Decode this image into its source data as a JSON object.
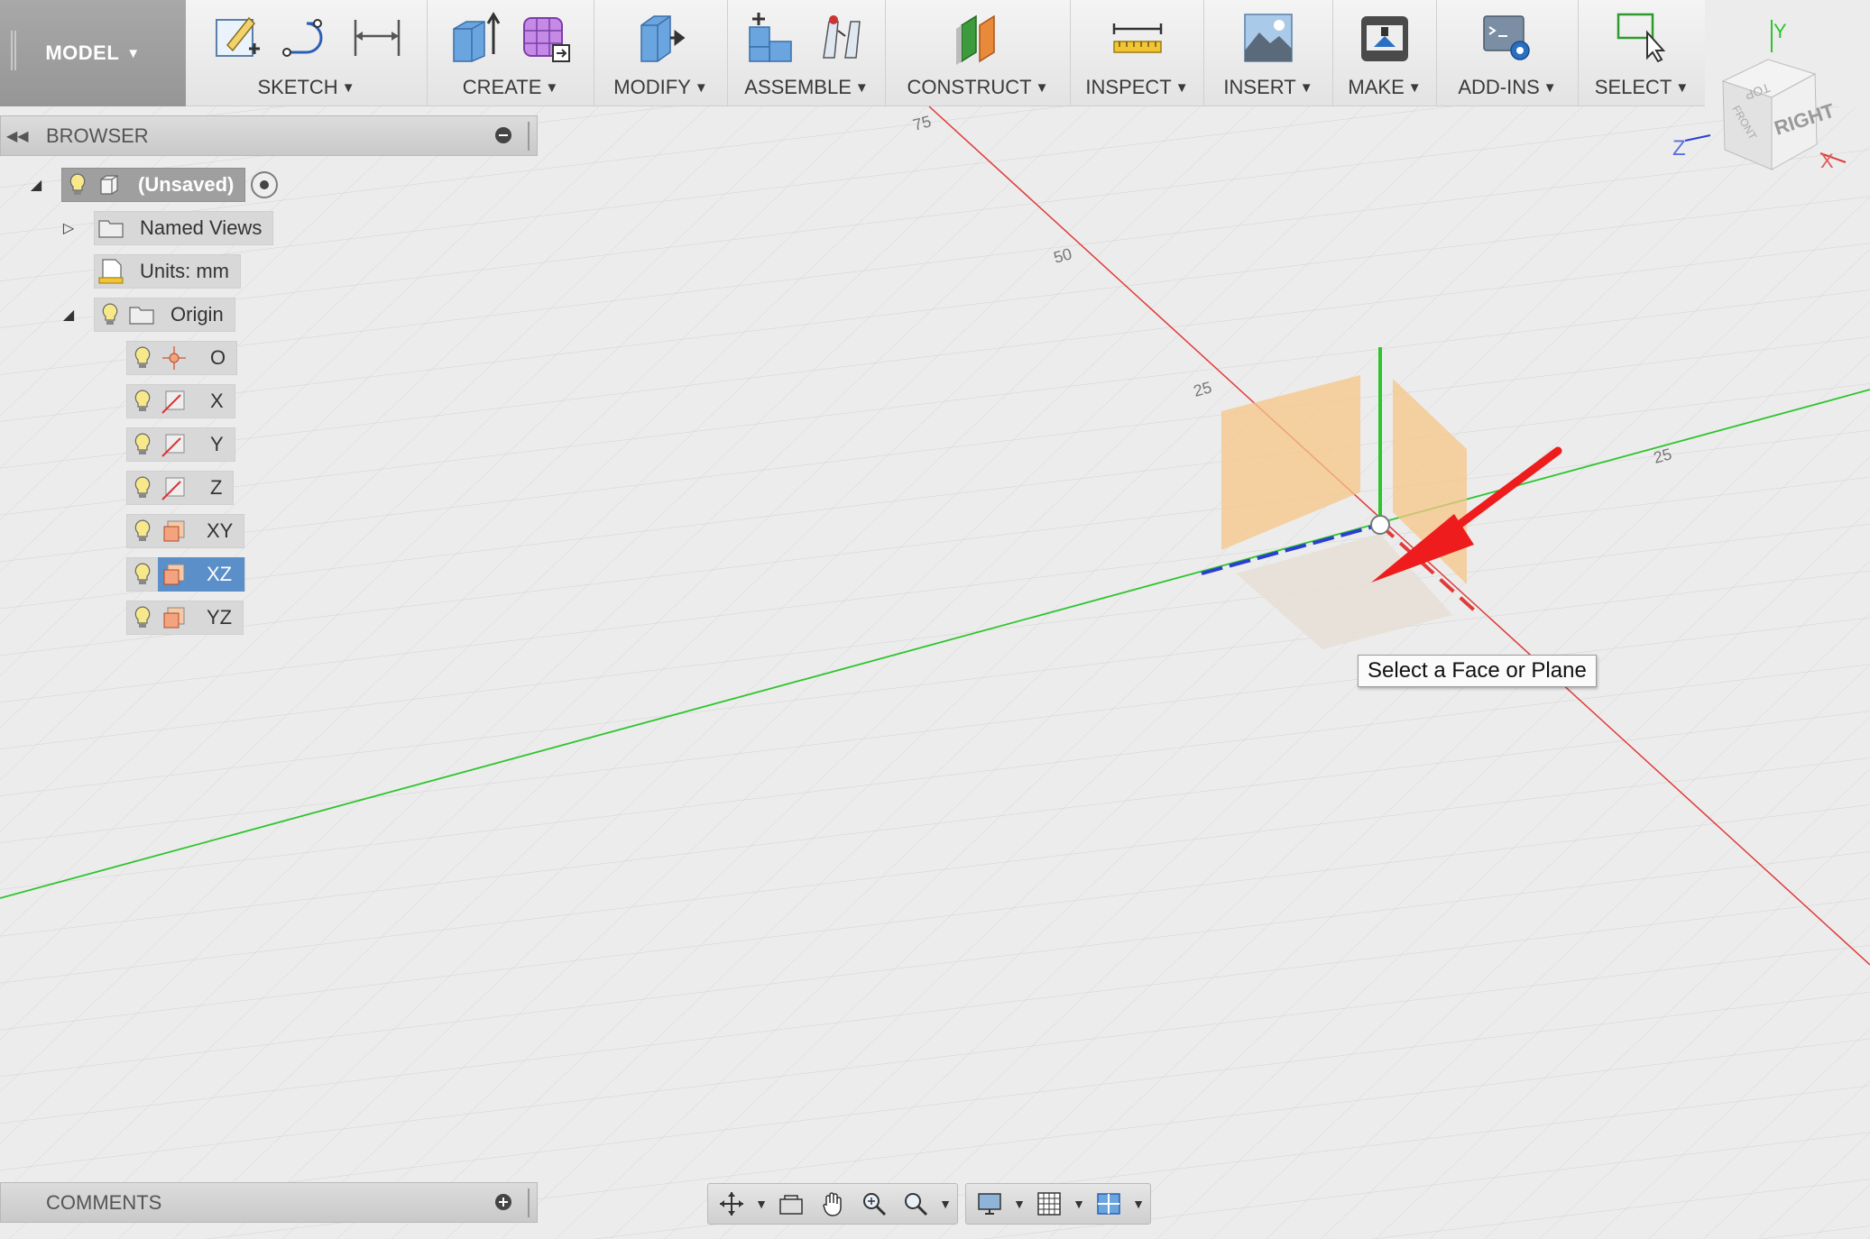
{
  "toolbar": {
    "mode_label": "MODEL",
    "groups": [
      {
        "label": "SKETCH",
        "icons": [
          "sketch-create-icon",
          "arc-line-icon",
          "dimension-icon"
        ]
      },
      {
        "label": "CREATE",
        "icons": [
          "extrude-icon",
          "form-grid-icon"
        ]
      },
      {
        "label": "MODIFY",
        "icons": [
          "press-pull-icon"
        ]
      },
      {
        "label": "ASSEMBLE",
        "icons": [
          "new-component-icon",
          "joint-icon"
        ]
      },
      {
        "label": "CONSTRUCT",
        "icons": [
          "offset-plane-icon"
        ]
      },
      {
        "label": "INSPECT",
        "icons": [
          "measure-icon"
        ]
      },
      {
        "label": "INSERT",
        "icons": [
          "insert-image-icon"
        ]
      },
      {
        "label": "MAKE",
        "icons": [
          "3d-print-icon"
        ]
      },
      {
        "label": "ADD-INS",
        "icons": [
          "scripts-icon"
        ]
      },
      {
        "label": "SELECT",
        "icons": [
          "select-window-icon"
        ]
      }
    ]
  },
  "browser": {
    "title": "BROWSER",
    "root": {
      "label": "(Unsaved)"
    },
    "named_views": {
      "label": "Named Views"
    },
    "units": {
      "label": "Units: mm"
    },
    "origin": {
      "label": "Origin"
    },
    "origin_items": [
      {
        "label": "O",
        "icon": "origin-point-icon",
        "selected": false
      },
      {
        "label": "X",
        "icon": "axis-icon",
        "selected": false
      },
      {
        "label": "Y",
        "icon": "axis-icon",
        "selected": false
      },
      {
        "label": "Z",
        "icon": "axis-icon",
        "selected": false
      },
      {
        "label": "XY",
        "icon": "plane-icon",
        "selected": false
      },
      {
        "label": "XZ",
        "icon": "plane-icon",
        "selected": true
      },
      {
        "label": "YZ",
        "icon": "plane-icon",
        "selected": false
      }
    ]
  },
  "canvas": {
    "tooltip": "Select a Face or Plane",
    "scale_labels": [
      "75",
      "50",
      "25",
      "25"
    ],
    "axis_colors": {
      "x": "#e03a3a",
      "y": "#2ec42e",
      "z": "#2a3fd0"
    },
    "plane_color": "#f7c587"
  },
  "viewcube": {
    "face_label": "RIGHT",
    "top_label": "TOP",
    "front_label": "FRONT",
    "axis_y": "Y",
    "axis_z": "Z",
    "axis_x": "X"
  },
  "comments": {
    "title": "COMMENTS"
  }
}
